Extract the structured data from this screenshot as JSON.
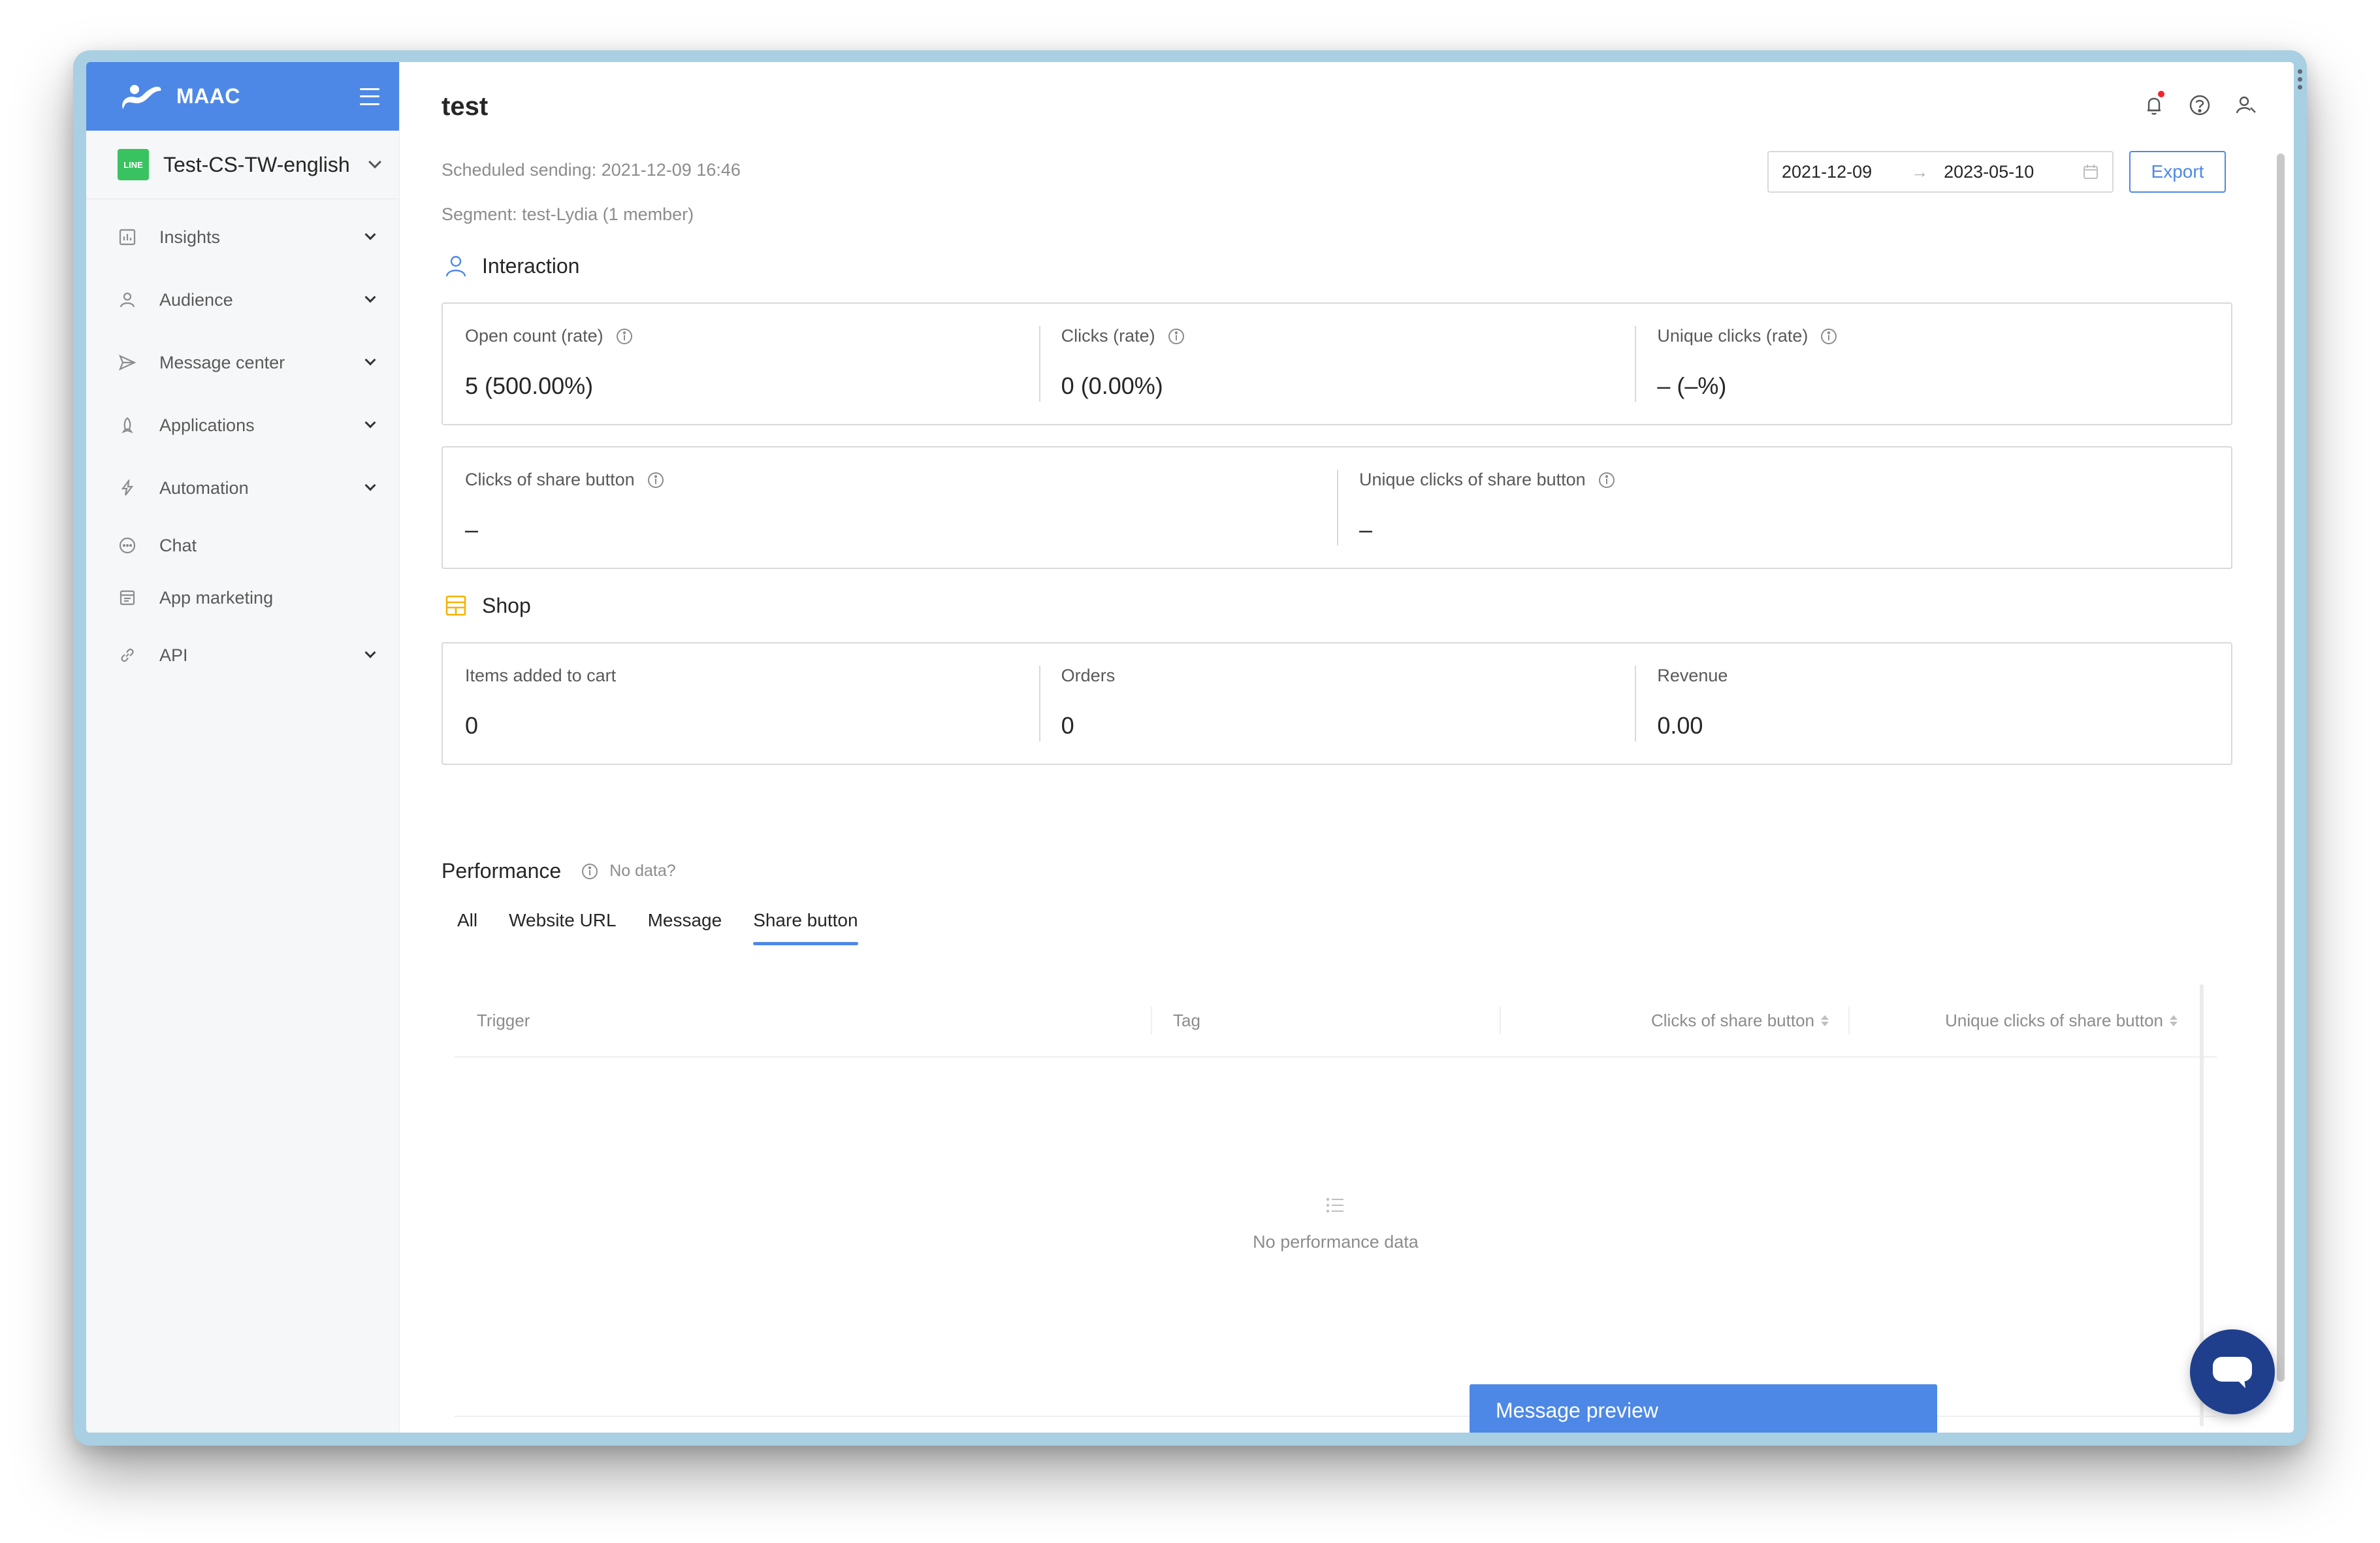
{
  "brand": {
    "name": "MAAC",
    "logo_icon": "maac-logo-icon",
    "menu_icon": "hamburger-icon"
  },
  "account": {
    "badge": "LINE",
    "name": "Test-CS-TW-english"
  },
  "sidebar": {
    "items": [
      {
        "label": "Insights",
        "icon": "bar-chart-icon",
        "expandable": true
      },
      {
        "label": "Audience",
        "icon": "user-icon",
        "expandable": true
      },
      {
        "label": "Message center",
        "icon": "send-icon",
        "expandable": true
      },
      {
        "label": "Applications",
        "icon": "rocket-icon",
        "expandable": true
      },
      {
        "label": "Automation",
        "icon": "lightning-icon",
        "expandable": true
      },
      {
        "label": "Chat",
        "icon": "chat-bubble-icon",
        "expandable": false
      },
      {
        "label": "App marketing",
        "icon": "app-marketing-icon",
        "expandable": false
      },
      {
        "label": "API",
        "icon": "api-link-icon",
        "expandable": true
      }
    ]
  },
  "header": {
    "title": "test",
    "scheduled": "Scheduled sending: 2021-12-09 16:46",
    "segment": "Segment: test-Lydia (1 member)",
    "date_start": "2021-12-09",
    "date_end": "2023-05-10",
    "export_label": "Export"
  },
  "interaction": {
    "title": "Interaction",
    "row1": [
      {
        "label": "Open count (rate)",
        "value": "5 (500.00%)"
      },
      {
        "label": "Clicks (rate)",
        "value": "0 (0.00%)"
      },
      {
        "label": "Unique clicks (rate)",
        "value": "– (–%)"
      }
    ],
    "row2": [
      {
        "label": "Clicks of share button",
        "value": "–"
      },
      {
        "label": "Unique clicks of share button",
        "value": "–"
      }
    ]
  },
  "shop": {
    "title": "Shop",
    "row": [
      {
        "label": "Items added to cart",
        "value": "0"
      },
      {
        "label": "Orders",
        "value": "0"
      },
      {
        "label": "Revenue",
        "value": "0.00"
      }
    ]
  },
  "performance": {
    "title": "Performance",
    "no_data_link": "No data?",
    "tabs": [
      "All",
      "Website URL",
      "Message",
      "Share button"
    ],
    "active_tab": "Share button",
    "columns": [
      "Trigger",
      "Tag",
      "Clicks of share button",
      "Unique clicks of share button"
    ],
    "empty_text": "No performance data"
  },
  "preview_label": "Message preview",
  "colors": {
    "accent": "#4d88e6",
    "fab": "#1f3f8c",
    "line_green": "#39c360",
    "shop_icon": "#f5b300"
  }
}
